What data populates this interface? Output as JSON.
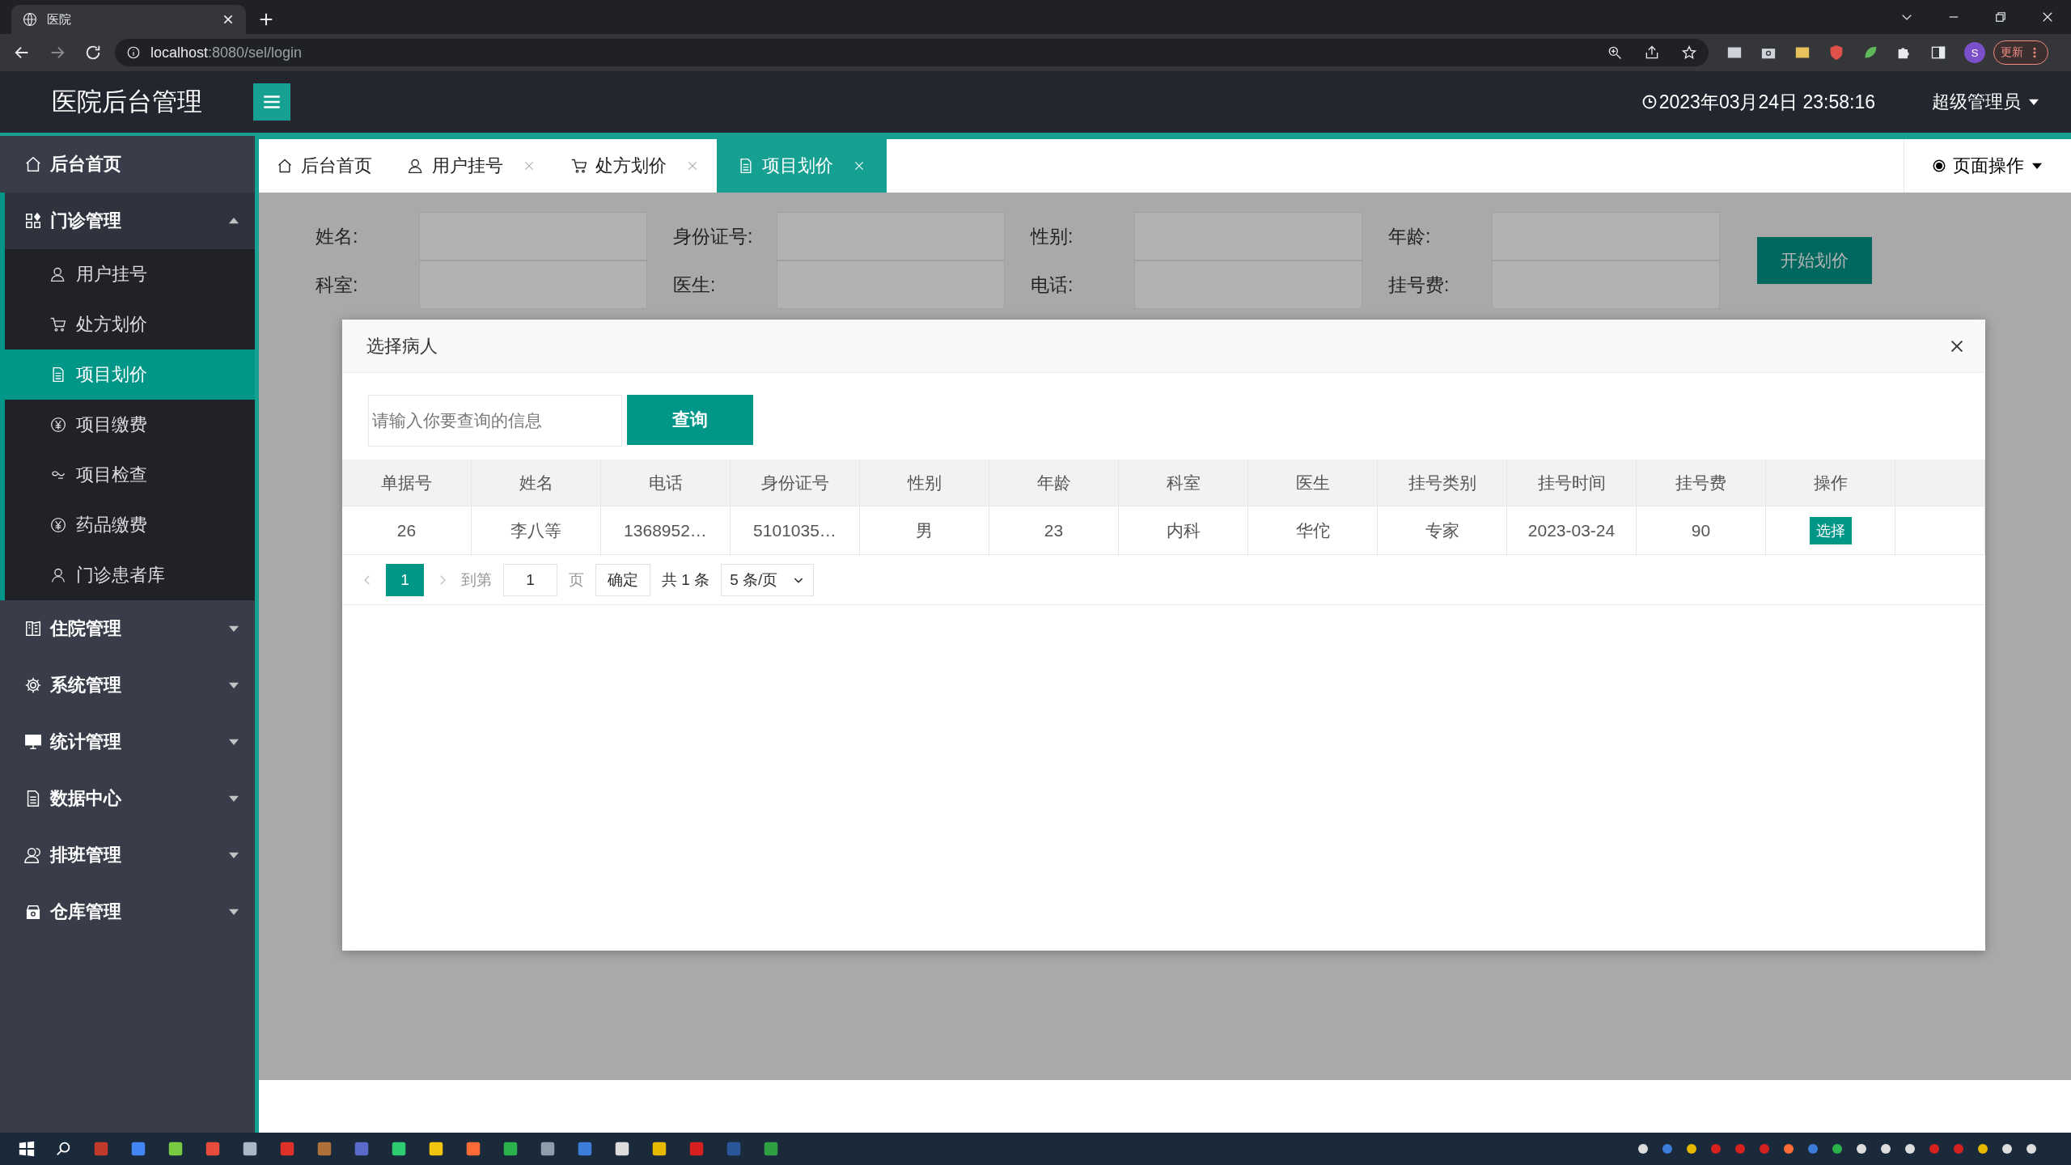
{
  "browser": {
    "tab_title": "医院",
    "url_host": "localhost",
    "url_path": ":8080/sel/login",
    "profile_initial": "S",
    "update_button": "更新"
  },
  "header": {
    "title": "医院后台管理",
    "clock": "2023年03月24日 23:58:16",
    "user": "超级管理员"
  },
  "sidebar": {
    "items": [
      {
        "label": "后台首页",
        "selected": false
      },
      {
        "label": "门诊管理",
        "expanded": true,
        "selected": false,
        "children": [
          {
            "label": "用户挂号",
            "selected": false
          },
          {
            "label": "处方划价",
            "selected": false
          },
          {
            "label": "项目划价",
            "selected": true
          },
          {
            "label": "项目缴费",
            "selected": false
          },
          {
            "label": "项目检查",
            "selected": false
          },
          {
            "label": "药品缴费",
            "selected": false
          },
          {
            "label": "门诊患者库",
            "selected": false
          }
        ]
      },
      {
        "label": "住院管理",
        "expanded": false,
        "selected": false
      },
      {
        "label": "系统管理",
        "expanded": false,
        "selected": false
      },
      {
        "label": "统计管理",
        "expanded": false,
        "selected": false
      },
      {
        "label": "数据中心",
        "expanded": false,
        "selected": false
      },
      {
        "label": "排班管理",
        "expanded": false,
        "selected": false
      },
      {
        "label": "仓库管理",
        "expanded": false,
        "selected": false
      }
    ]
  },
  "tabs": [
    {
      "label": "后台首页",
      "closable": false,
      "selected": false
    },
    {
      "label": "用户挂号",
      "closable": true,
      "selected": false
    },
    {
      "label": "处方划价",
      "closable": true,
      "selected": false
    },
    {
      "label": "项目划价",
      "closable": true,
      "selected": true
    }
  ],
  "page_actions": "页面操作",
  "form": {
    "fields": [
      {
        "label": "姓名:"
      },
      {
        "label": "身份证号:"
      },
      {
        "label": "性别:"
      },
      {
        "label": "年龄:"
      },
      {
        "label": "科室:"
      },
      {
        "label": "医生:"
      },
      {
        "label": "电话:"
      },
      {
        "label": "挂号费:"
      }
    ],
    "button": "开始划价"
  },
  "modal": {
    "title": "选择病人",
    "search": {
      "placeholder": "请输入你要查询的信息"
    },
    "search_button": "查询",
    "table": {
      "columns": [
        "单据号",
        "姓名",
        "电话",
        "身份证号",
        "性别",
        "年龄",
        "科室",
        "医生",
        "挂号类别",
        "挂号时间",
        "挂号费",
        "操作"
      ],
      "rows": [
        {
          "cells": [
            "26",
            "李八等",
            "1368952…",
            "5101035…",
            "男",
            "23",
            "内科",
            "华佗",
            "专家",
            "2023-03-24",
            "90"
          ],
          "action": "选择"
        }
      ]
    },
    "pagination": {
      "pages": [
        {
          "label": "1",
          "selected": true
        }
      ],
      "goto_label": "到第",
      "goto_value": "1",
      "page_suffix": "页",
      "confirm": "确定",
      "total": "共 1 条",
      "page_size": "5 条/页"
    }
  }
}
